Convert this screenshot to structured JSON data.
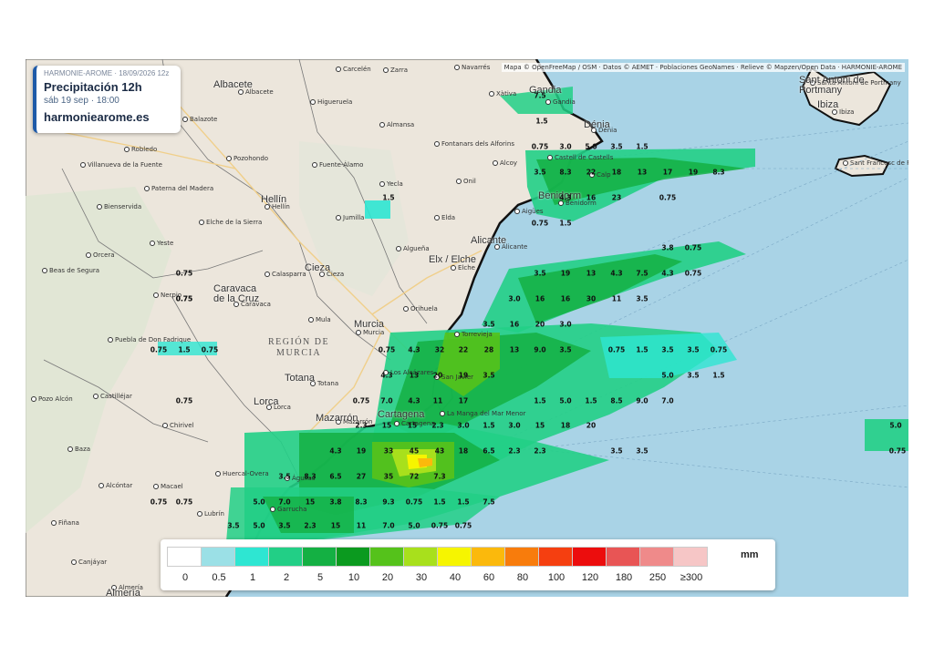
{
  "attribution": "Mapa © OpenFreeMap / OSM · Datos © AEMET · Poblaciones GeoNames · Relieve © Mapzen/Open Data · HARMONIE-AROME",
  "infobox": {
    "model": "HARMONIE-AROME · 18/09/2026 12z",
    "title": "Precipitación 12h",
    "date": "sáb 19 sep · 18:00",
    "site": "harmoniearome.es"
  },
  "legend": {
    "unit": "mm",
    "labels": [
      "0",
      "0.5",
      "1",
      "2",
      "5",
      "10",
      "20",
      "30",
      "40",
      "60",
      "80",
      "100",
      "120",
      "180",
      "250",
      "≥300"
    ],
    "colors": [
      "#ffffff",
      "#9be0e6",
      "#2ee6d2",
      "#22cf86",
      "#14b043",
      "#0b9a1f",
      "#55c21b",
      "#a8e01c",
      "#f6f500",
      "#fbb90c",
      "#f87c0c",
      "#f53f10",
      "#ec0d0d",
      "#e85555",
      "#ef8a8a",
      "#f6c6c6"
    ]
  },
  "regions": [
    {
      "text": "REGIÓN DE",
      "text2": "MURCIA"
    }
  ],
  "places": [
    {
      "name": "Carcelén"
    },
    {
      "name": "Zarra"
    },
    {
      "name": "Navarrés"
    },
    {
      "name": "Xàtiva"
    },
    {
      "name": "Albacete"
    },
    {
      "name": "Higueruela"
    },
    {
      "name": "Almansa"
    },
    {
      "name": "Balazote"
    },
    {
      "name": "Fontanars dels Alforins"
    },
    {
      "name": "Alcoy"
    },
    {
      "name": "Robledo"
    },
    {
      "name": "Pozohondo"
    },
    {
      "name": "Villanueva de la Fuente"
    },
    {
      "name": "Fuente-Álamo"
    },
    {
      "name": "Yecla"
    },
    {
      "name": "Onil"
    },
    {
      "name": "Paterna del Madera"
    },
    {
      "name": "Hellín"
    },
    {
      "name": "Jumilla"
    },
    {
      "name": "Elche de la Sierra"
    },
    {
      "name": "Bienservida"
    },
    {
      "name": "Elda"
    },
    {
      "name": "Alicante"
    },
    {
      "name": "Yeste"
    },
    {
      "name": "Algueña"
    },
    {
      "name": "Orcera"
    },
    {
      "name": "Elche"
    },
    {
      "name": "Beas de Segura"
    },
    {
      "name": "Calasparra"
    },
    {
      "name": "Cieza"
    },
    {
      "name": "Nerpio"
    },
    {
      "name": "Caravaca"
    },
    {
      "name": "Orihuela"
    },
    {
      "name": "Mula"
    },
    {
      "name": "Murcia"
    },
    {
      "name": "Torrevieja"
    },
    {
      "name": "Puebla de Don Fadrique"
    },
    {
      "name": "Totana"
    },
    {
      "name": "Pozo Alcón"
    },
    {
      "name": "Castilléjar"
    },
    {
      "name": "Lorca"
    },
    {
      "name": "Mazarrón"
    },
    {
      "name": "Cartagena"
    },
    {
      "name": "Chirivel"
    },
    {
      "name": "La Manga del Mar Menor"
    },
    {
      "name": "Los Alcázares"
    },
    {
      "name": "San Javier"
    },
    {
      "name": "Baza"
    },
    {
      "name": "Huercal-Overa"
    },
    {
      "name": "Águilas"
    },
    {
      "name": "Alcóntar"
    },
    {
      "name": "Macael"
    },
    {
      "name": "Lubrín"
    },
    {
      "name": "Garrucha"
    },
    {
      "name": "Fiñana"
    },
    {
      "name": "Canjáyar"
    },
    {
      "name": "Almería"
    },
    {
      "name": "Gandia"
    },
    {
      "name": "Dénia"
    },
    {
      "name": "Calp"
    },
    {
      "name": "Castell de Castells"
    },
    {
      "name": "Benidorm"
    },
    {
      "name": "Aigües"
    },
    {
      "name": "Santa Antoni de Portmany"
    },
    {
      "name": "Ibiza"
    },
    {
      "name": "Sant Francesc de Formentera"
    }
  ],
  "bigplaces": [
    {
      "name": "Albacete"
    },
    {
      "name": "Hellín"
    },
    {
      "name": "Alicante"
    },
    {
      "name": "Elx / Elche"
    },
    {
      "name": "Cieza"
    },
    {
      "name": "Caravaca de la Cruz"
    },
    {
      "name": "Murcia"
    },
    {
      "name": "Totana"
    },
    {
      "name": "Lorca"
    },
    {
      "name": "Mazarrón"
    },
    {
      "name": "Cartagena"
    },
    {
      "name": "Almería"
    },
    {
      "name": "Sant Antoni de Portmany"
    },
    {
      "name": "Ibiza"
    },
    {
      "name": "Gandia"
    },
    {
      "name": "Dénia"
    },
    {
      "name": "Benidorm"
    }
  ],
  "values": [
    "7.5",
    "1.5",
    "0.75",
    "3.0",
    "5.0",
    "3.5",
    "1.5",
    "3.5",
    "8.3",
    "22",
    "18",
    "13",
    "17",
    "19",
    "8.3",
    "4.3",
    "16",
    "23",
    "0.75",
    "0.75",
    "1.5",
    "1.5",
    "0.75",
    "0.75",
    "3.8",
    "0.75",
    "3.5",
    "19",
    "13",
    "4.3",
    "7.5",
    "4.3",
    "0.75",
    "3.0",
    "16",
    "16",
    "30",
    "11",
    "3.5",
    "3.5",
    "16",
    "20",
    "3.0",
    "0.75",
    "1.5",
    "0.75",
    "0.75",
    "4.3",
    "32",
    "22",
    "28",
    "13",
    "9.0",
    "3.5",
    "0.75",
    "1.5",
    "3.5",
    "3.5",
    "0.75",
    "4.3",
    "13",
    "20",
    "19",
    "3.5",
    "5.0",
    "3.5",
    "1.5",
    "0.75",
    "0.75",
    "7.0",
    "4.3",
    "11",
    "17",
    "1.5",
    "5.0",
    "1.5",
    "8.5",
    "9.0",
    "7.0",
    "2.3",
    "15",
    "15",
    "2.3",
    "3.0",
    "1.5",
    "3.0",
    "15",
    "18",
    "20",
    "5.0",
    "5.0",
    "0.75",
    "4.3",
    "19",
    "33",
    "45",
    "43",
    "18",
    "6.5",
    "2.3",
    "2.3",
    "3.5",
    "3.5",
    "3.5",
    "8.3",
    "6.5",
    "27",
    "35",
    "72",
    "7.3",
    "0.75",
    "0.75",
    "5.0",
    "7.0",
    "15",
    "3.8",
    "8.3",
    "9.3",
    "0.75",
    "1.5",
    "1.5",
    "7.5",
    "3.5",
    "5.0",
    "3.5",
    "2.3",
    "15",
    "11",
    "7.0",
    "5.0",
    "0.75",
    "0.75",
    "0.75"
  ]
}
